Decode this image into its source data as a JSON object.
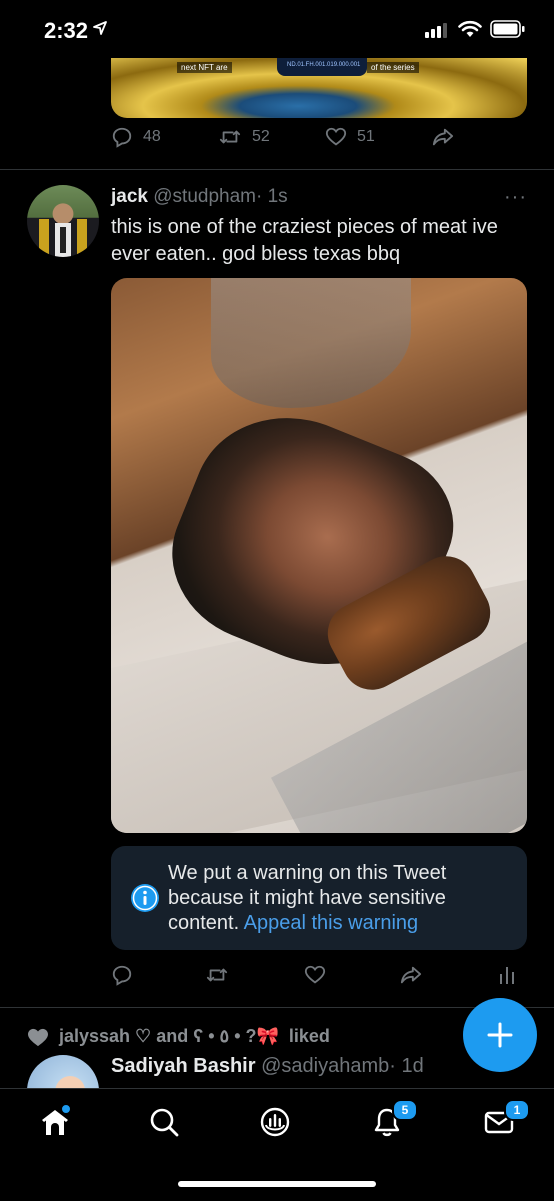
{
  "status_bar": {
    "time": "2:32"
  },
  "previous_tweet": {
    "media_captions": [
      "next NFT are",
      "of the series"
    ],
    "nft_id": "ND.01.FH.001.019.000.001",
    "replies": "48",
    "retweets": "52",
    "likes": "51"
  },
  "tweet": {
    "name": "jack",
    "handle": "@studpham",
    "time": "· 1s",
    "more": "···",
    "text": "this is one of the craziest pieces of meat ive ever eaten.. god bless texas bbq",
    "warning_text": "We put a warning on this Tweet because it might have sensitive content.",
    "warning_link": "Appeal this warning"
  },
  "liked_row": {
    "who": "jalyssah ♡ and ʕ • ٥ • ?🎀",
    "verb": "liked"
  },
  "next_tweet": {
    "name": "Sadiyah Bashir",
    "handle": "@sadiyahamb",
    "time": "· 1d"
  },
  "tabbar": {
    "notifications_badge": "5",
    "messages_badge": "1"
  },
  "colors": {
    "accent": "#1d9bf0",
    "link": "#4a9ee9",
    "muted": "#71767b",
    "warning_bg": "#16202b"
  }
}
